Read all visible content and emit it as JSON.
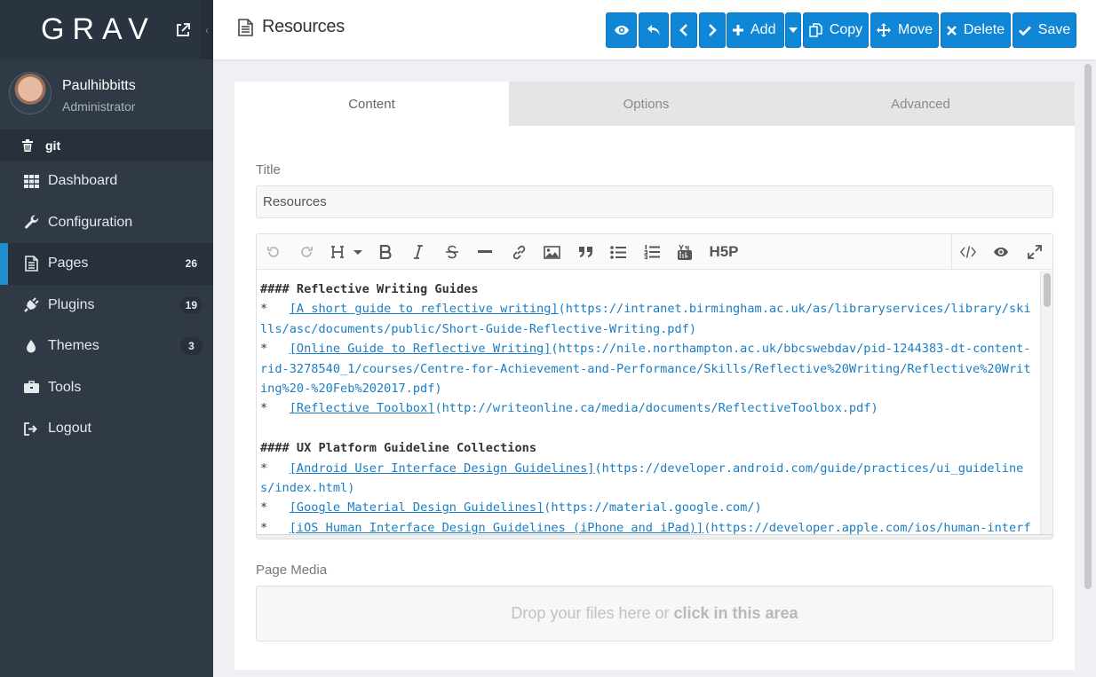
{
  "sidebar": {
    "brand": "GRAV",
    "collapse_glyph": "‹",
    "user": {
      "name": "Paulhibbitts",
      "role": "Administrator"
    },
    "git_label": "git",
    "items": [
      {
        "label": "Dashboard",
        "icon": "th-icon"
      },
      {
        "label": "Configuration",
        "icon": "wrench-icon"
      },
      {
        "label": "Pages",
        "icon": "file-icon",
        "badge": "26",
        "active": true
      },
      {
        "label": "Plugins",
        "icon": "plug-icon",
        "badge": "19"
      },
      {
        "label": "Themes",
        "icon": "tint-icon",
        "badge": "3"
      },
      {
        "label": "Tools",
        "icon": "briefcase-icon"
      },
      {
        "label": "Logout",
        "icon": "sign-out-icon"
      }
    ]
  },
  "topbar": {
    "title": "Resources",
    "buttons": {
      "add": "Add",
      "copy": "Copy",
      "move": "Move",
      "delete": "Delete",
      "save": "Save"
    }
  },
  "tabs": [
    "Content",
    "Options",
    "Advanced"
  ],
  "form": {
    "title_label": "Title",
    "title_value": "Resources",
    "media_label": "Page Media",
    "dropzone_text": "Drop your files here or",
    "dropzone_bold": "click in this area"
  },
  "editor": {
    "h5p_label": "H5P",
    "lines": [
      {
        "kind": "heading",
        "text": "#### Reflective Writing Guides"
      },
      {
        "kind": "item",
        "link": "[A short guide to reflective writing]",
        "url": "(https://intranet.birmingham.ac.uk/as/libraryservices/library/skills/asc/documents/public/Short-Guide-Reflective-Writing.pdf)"
      },
      {
        "kind": "item",
        "link": "[Online Guide to Reflective Writing]",
        "url": "(https://nile.northampton.ac.uk/bbcswebdav/pid-1244383-dt-content-rid-3278540_1/courses/Centre-for-Achievement-and-Performance/Skills/Reflective%20Writing/Reflective%20Writing%20-%20Feb%202017.pdf)"
      },
      {
        "kind": "item",
        "link": "[Reflective Toolbox]",
        "url": "(http://writeonline.ca/media/documents/ReflectiveToolbox.pdf)"
      },
      {
        "kind": "gap"
      },
      {
        "kind": "heading",
        "text": "#### UX Platform Guideline Collections"
      },
      {
        "kind": "item",
        "link": "[Android User Interface Design Guidelines]",
        "url": "(https://developer.android.com/guide/practices/ui_guidelines/index.html)"
      },
      {
        "kind": "item",
        "link": "[Google Material Design Guidelines]",
        "url": "(https://material.google.com/)"
      },
      {
        "kind": "item",
        "link": "[iOS Human Interface Design Guidelines (iPhone and iPad)]",
        "url": "(https://developer.apple.com/ios/human-interface-guidelines/)"
      }
    ]
  },
  "colors": {
    "sidebar": "#2f3a46",
    "accent": "#0f86d6",
    "active_bar": "#1f8ecd",
    "link": "#1a7ec2"
  }
}
